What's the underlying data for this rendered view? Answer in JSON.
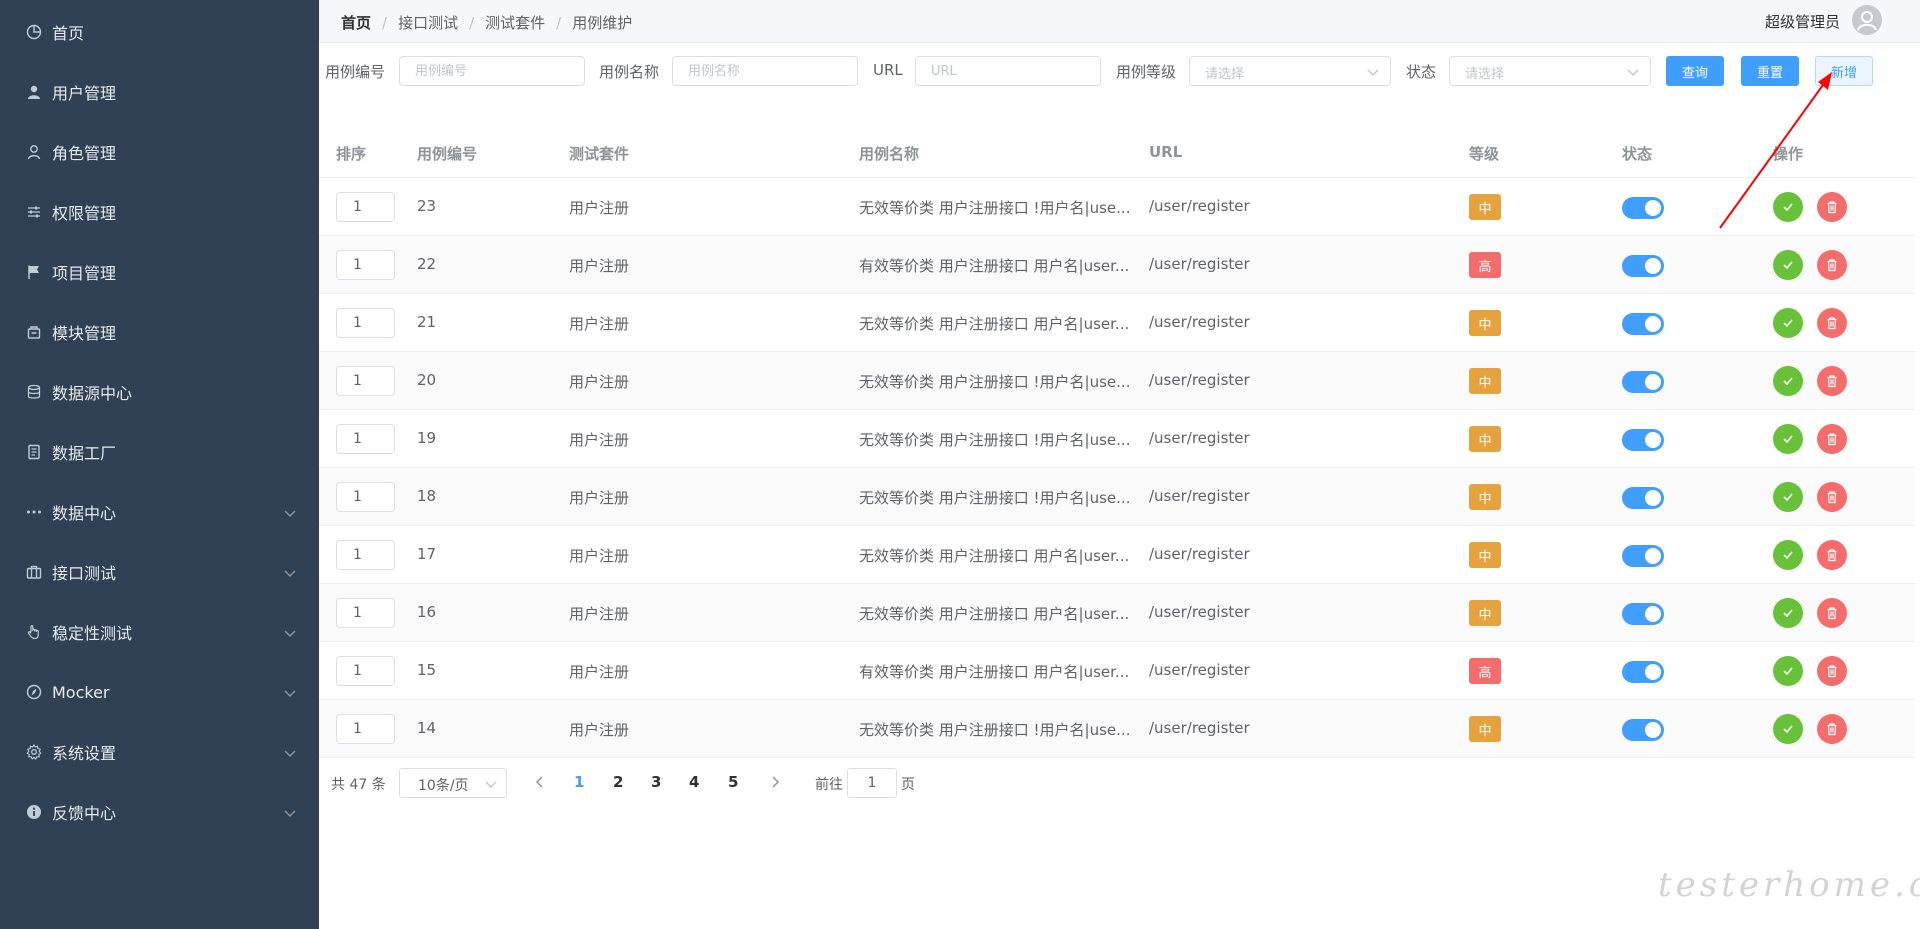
{
  "sidebar": {
    "items": [
      {
        "label": "首页",
        "icon": "dashboard-icon",
        "expandable": false
      },
      {
        "label": "用户管理",
        "icon": "user-icon",
        "expandable": false
      },
      {
        "label": "角色管理",
        "icon": "role-icon",
        "expandable": false
      },
      {
        "label": "权限管理",
        "icon": "sliders-icon",
        "expandable": false
      },
      {
        "label": "项目管理",
        "icon": "flag-icon",
        "expandable": false
      },
      {
        "label": "模块管理",
        "icon": "box-icon",
        "expandable": false
      },
      {
        "label": "数据源中心",
        "icon": "database-icon",
        "expandable": false
      },
      {
        "label": "数据工厂",
        "icon": "document-icon",
        "expandable": false
      },
      {
        "label": "数据中心",
        "icon": "more-icon",
        "expandable": true
      },
      {
        "label": "接口测试",
        "icon": "briefcase-icon",
        "expandable": true
      },
      {
        "label": "稳定性测试",
        "icon": "hand-icon",
        "expandable": true
      },
      {
        "label": "Mocker",
        "icon": "compass-icon",
        "expandable": true
      },
      {
        "label": "系统设置",
        "icon": "gear-icon",
        "expandable": true
      },
      {
        "label": "反馈中心",
        "icon": "info-icon",
        "expandable": true
      }
    ]
  },
  "header": {
    "breadcrumb": [
      "首页",
      "接口测试",
      "测试套件",
      "用例维护"
    ],
    "separator": "/",
    "user_name": "超级管理员"
  },
  "search": {
    "case_no_label": "用例编号",
    "case_no_placeholder": "用例编号",
    "case_name_label": "用例名称",
    "case_name_placeholder": "用例名称",
    "url_label": "URL",
    "url_placeholder": "URL",
    "level_label": "用例等级",
    "level_placeholder": "请选择",
    "status_label": "状态",
    "status_placeholder": "请选择",
    "query_button": "查询",
    "reset_button": "重置",
    "add_button": "新增"
  },
  "table": {
    "columns": [
      "排序",
      "用例编号",
      "测试套件",
      "用例名称",
      "URL",
      "等级",
      "状态",
      "操作"
    ],
    "rows": [
      {
        "sort": "1",
        "id": "23",
        "suite": "用户注册",
        "name": "无效等价类 用户注册接口 !用户名|use...",
        "url": "/user/register",
        "level": "中",
        "enabled": true
      },
      {
        "sort": "1",
        "id": "22",
        "suite": "用户注册",
        "name": "有效等价类 用户注册接口 用户名|user...",
        "url": "/user/register",
        "level": "高",
        "enabled": true
      },
      {
        "sort": "1",
        "id": "21",
        "suite": "用户注册",
        "name": "无效等价类 用户注册接口 用户名|user...",
        "url": "/user/register",
        "level": "中",
        "enabled": true
      },
      {
        "sort": "1",
        "id": "20",
        "suite": "用户注册",
        "name": "无效等价类 用户注册接口 !用户名|use...",
        "url": "/user/register",
        "level": "中",
        "enabled": true
      },
      {
        "sort": "1",
        "id": "19",
        "suite": "用户注册",
        "name": "无效等价类 用户注册接口 !用户名|use...",
        "url": "/user/register",
        "level": "中",
        "enabled": true
      },
      {
        "sort": "1",
        "id": "18",
        "suite": "用户注册",
        "name": "无效等价类 用户注册接口 !用户名|use...",
        "url": "/user/register",
        "level": "中",
        "enabled": true
      },
      {
        "sort": "1",
        "id": "17",
        "suite": "用户注册",
        "name": "无效等价类 用户注册接口 用户名|user...",
        "url": "/user/register",
        "level": "中",
        "enabled": true
      },
      {
        "sort": "1",
        "id": "16",
        "suite": "用户注册",
        "name": "无效等价类 用户注册接口 用户名|user...",
        "url": "/user/register",
        "level": "中",
        "enabled": true
      },
      {
        "sort": "1",
        "id": "15",
        "suite": "用户注册",
        "name": "有效等价类 用户注册接口 用户名|user...",
        "url": "/user/register",
        "level": "高",
        "enabled": true
      },
      {
        "sort": "1",
        "id": "14",
        "suite": "用户注册",
        "name": "无效等价类 用户注册接口 !用户名|use...",
        "url": "/user/register",
        "level": "中",
        "enabled": true
      }
    ]
  },
  "pagination": {
    "total": "共 47 条",
    "page_size": "10条/页",
    "pages": [
      "1",
      "2",
      "3",
      "4",
      "5"
    ],
    "current": "1",
    "goto_label": "前往",
    "goto_value": "1",
    "goto_unit": "页"
  },
  "watermark": "testerhome.com",
  "colors": {
    "sidebar_bg": "#304156",
    "primary": "#409eff",
    "level_medium": "#e6a23c",
    "level_high": "#f56c6c",
    "success": "#67c23a",
    "danger": "#f56c6c",
    "annotation": "#ff0000"
  }
}
